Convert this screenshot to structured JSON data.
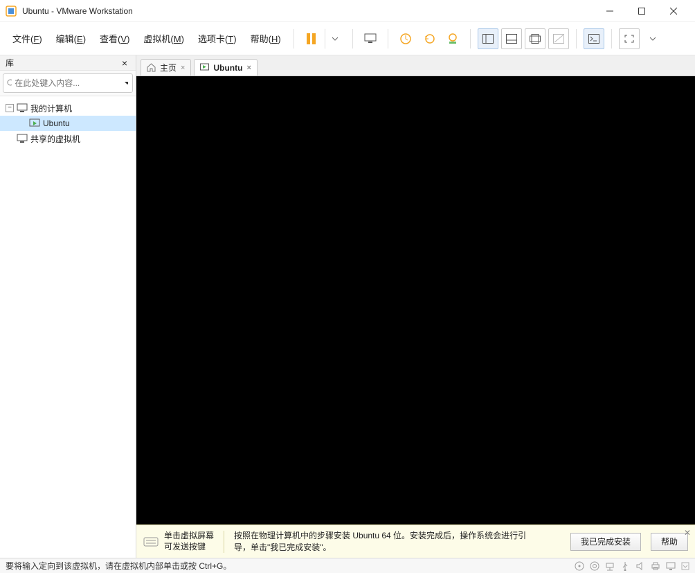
{
  "title": "Ubuntu  - VMware Workstation",
  "menu": {
    "file": {
      "label": "文件",
      "key": "F"
    },
    "edit": {
      "label": "编辑",
      "key": "E"
    },
    "view": {
      "label": "查看",
      "key": "V"
    },
    "vm": {
      "label": "虚拟机",
      "key": "M"
    },
    "tabs": {
      "label": "选项卡",
      "key": "T"
    },
    "help": {
      "label": "帮助",
      "key": "H"
    }
  },
  "sidebar": {
    "title": "库",
    "search_placeholder": "在此处键入内容...",
    "nodes": {
      "my_computer": "我的计算机",
      "ubuntu": "Ubuntu",
      "shared": "共享的虚拟机"
    }
  },
  "tabs_area": {
    "home": "主页",
    "ubuntu": "Ubuntu"
  },
  "hint": {
    "left_line1": "单击虚拟屏幕",
    "left_line2": "可发送按键",
    "main": "按照在物理计算机中的步骤安装 Ubuntu 64 位。安装完成后，操作系统会进行引导，单击\"我已完成安装\"。",
    "btn_done": "我已完成安装",
    "btn_help": "帮助"
  },
  "status_text": "要将输入定向到该虚拟机，请在虚拟机内部单击或按 Ctrl+G。"
}
